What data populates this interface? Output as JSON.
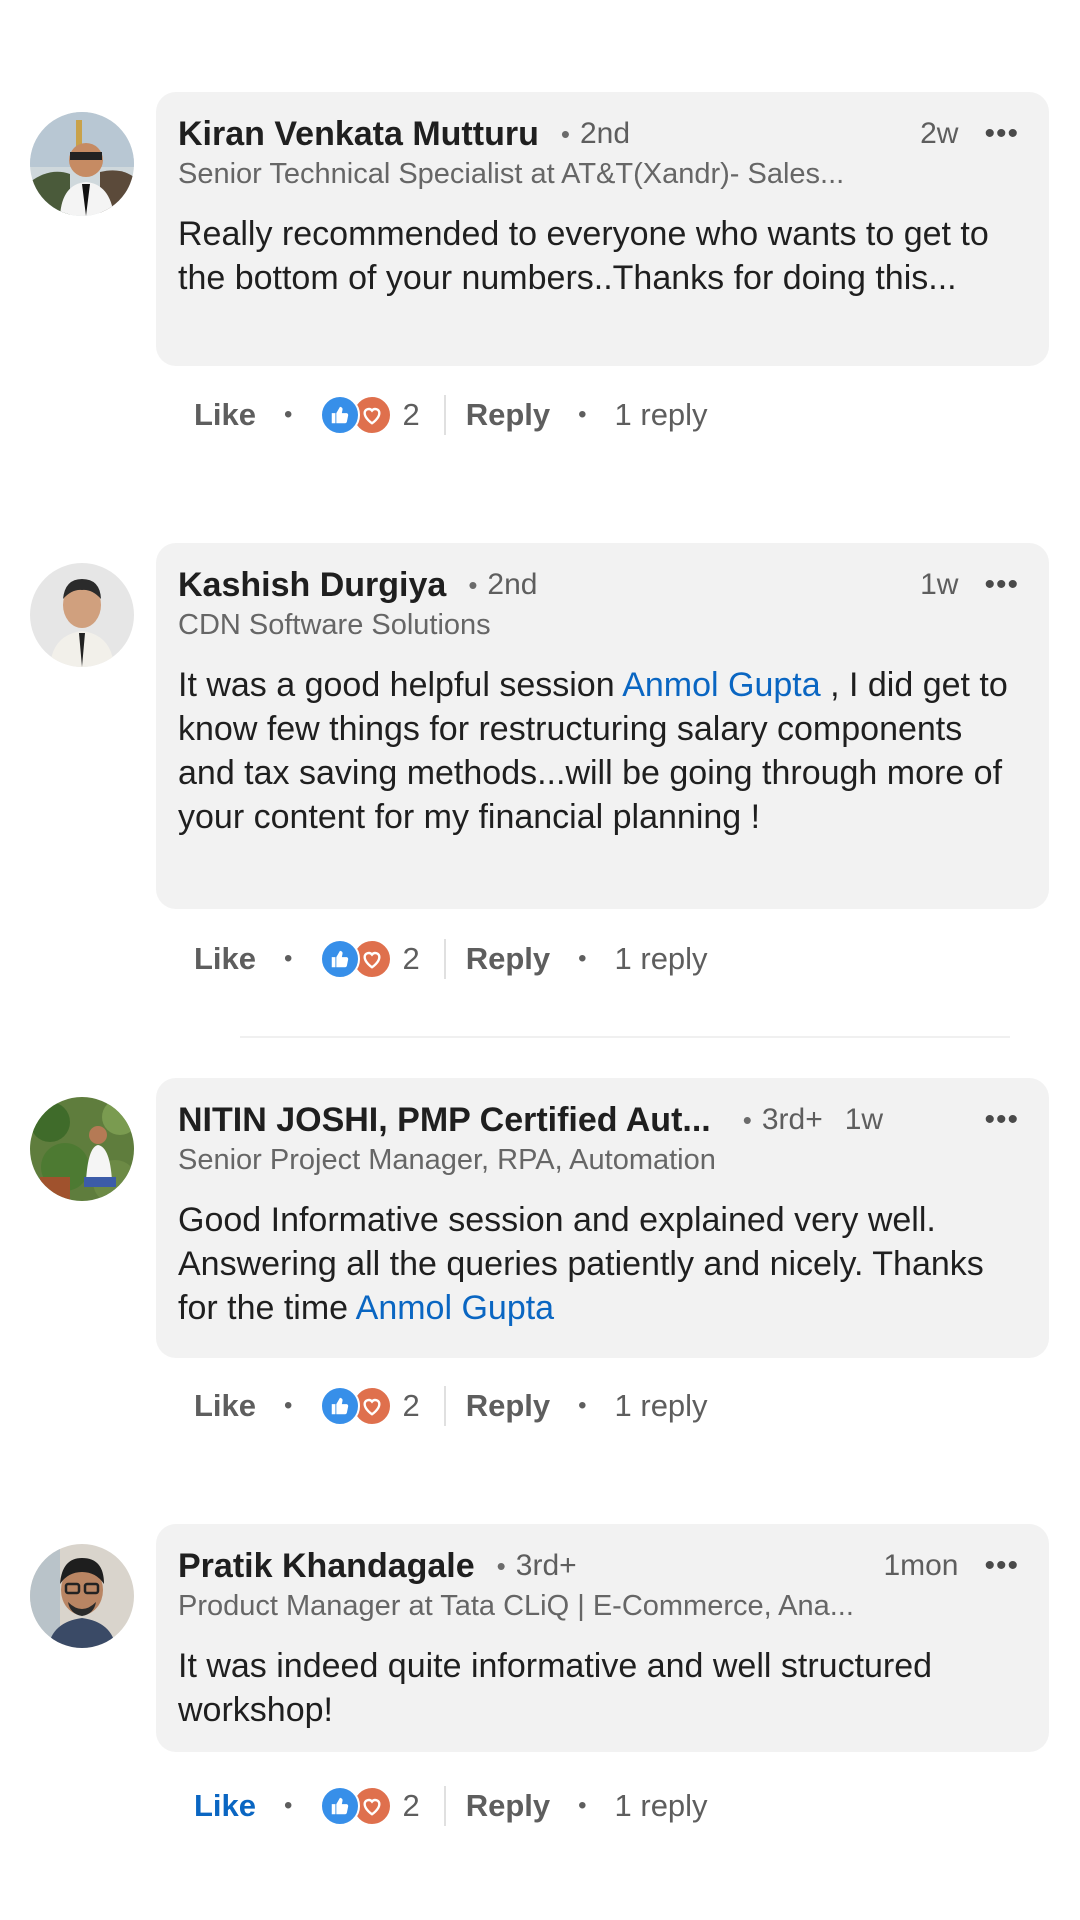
{
  "comments": [
    {
      "name": "Kiran Venkata Mutturu",
      "degree": "2nd",
      "time": "2w",
      "headline": "Senior Technical Specialist at AT&T(Xandr)- Sales...",
      "text_before": "Really recommended to everyone who wants to get to the bottom of your numbers..Thanks for doing this...",
      "mention": "",
      "text_after": "",
      "like_label": "Like",
      "reaction_count": "2",
      "reply_label": "Reply",
      "replies_label": "1 reply"
    },
    {
      "name": "Kashish Durgiya",
      "degree": "2nd",
      "time": "1w",
      "headline": "CDN Software Solutions",
      "text_before": "It was a good helpful session ",
      "mention": "Anmol Gupta",
      "text_after": " , I did get to know few things for restructuring salary components and tax saving methods...will be going through more of your content for my financial planning !",
      "like_label": "Like",
      "reaction_count": "2",
      "reply_label": "Reply",
      "replies_label": "1 reply"
    },
    {
      "name": "NITIN JOSHI, PMP Certified Aut...",
      "degree": "3rd+",
      "time": "1w",
      "headline": "Senior Project Manager, RPA, Automation",
      "text_before": "Good Informative session and explained very well. Answering all the queries patiently and nicely. Thanks for the time ",
      "mention": "Anmol Gupta",
      "text_after": "",
      "like_label": "Like",
      "reaction_count": "2",
      "reply_label": "Reply",
      "replies_label": "1 reply"
    },
    {
      "name": "Pratik Khandagale",
      "degree": "3rd+",
      "time": "1mon",
      "headline": "Product Manager at Tata CLiQ | E-Commerce, Ana...",
      "text_before": "It was indeed quite informative and well structured workshop!",
      "mention": "",
      "text_after": "",
      "like_label": "Like",
      "reaction_count": "2",
      "reply_label": "Reply",
      "replies_label": "1 reply"
    }
  ],
  "colors": {
    "bubble": "#f2f2f2",
    "mention": "#0a66c2",
    "like_active": "#0a66c2",
    "like_reaction": "#378fe9",
    "love_reaction": "#df704d"
  },
  "icons": [
    "like-reaction-icon",
    "love-reaction-icon",
    "more-options-icon"
  ]
}
